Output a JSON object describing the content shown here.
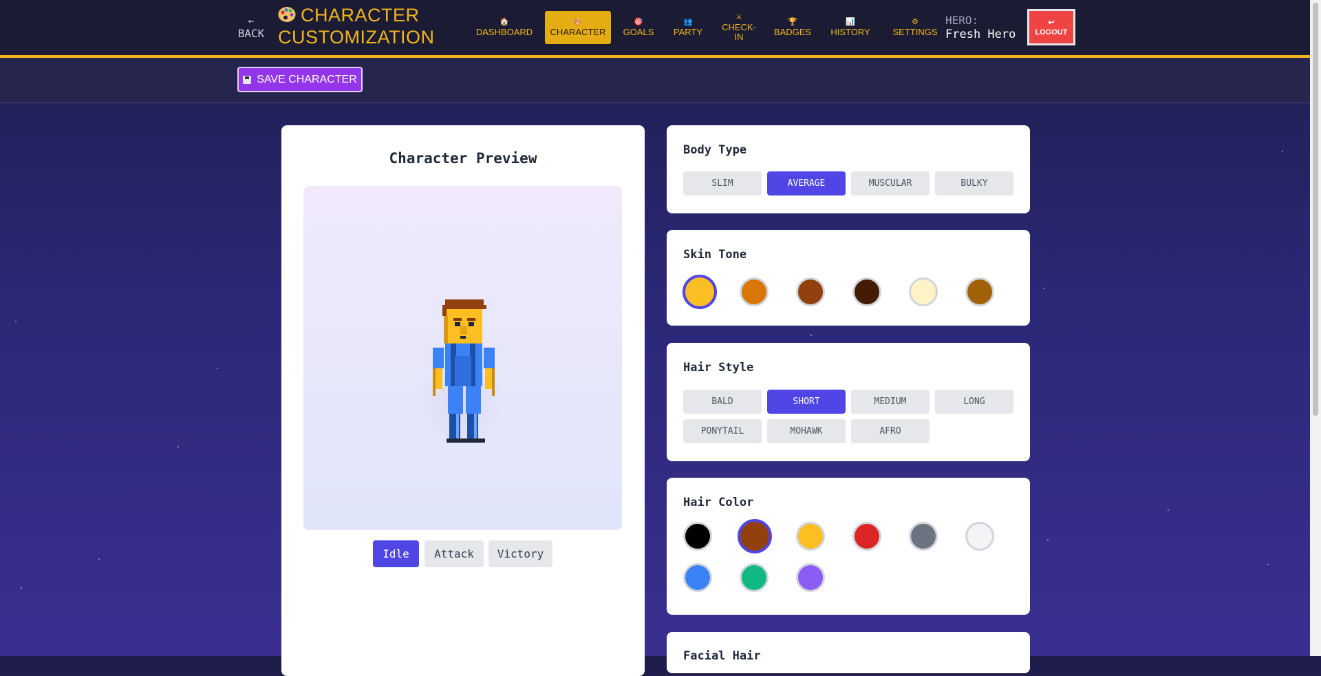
{
  "header": {
    "back_label": "BACK",
    "back_arrow": "←",
    "title_line1": "CHARACTER",
    "title_line2": "CUSTOMIZATION",
    "nav": [
      {
        "icon": "🏠",
        "label": "DASHBOARD",
        "active": false
      },
      {
        "icon": "🎨",
        "label": "CHARACTER",
        "active": true
      },
      {
        "icon": "🎯",
        "label": "GOALS",
        "active": false
      },
      {
        "icon": "👥",
        "label": "PARTY",
        "active": false
      },
      {
        "icon": "⚔",
        "label": "CHECK-IN",
        "active": false
      },
      {
        "icon": "🏆",
        "label": "BADGES",
        "active": false
      },
      {
        "icon": "📊",
        "label": "HISTORY",
        "active": false
      },
      {
        "icon": "⚙",
        "label": "SETTINGS",
        "active": false
      }
    ],
    "checkin_line1": "CHECK-",
    "checkin_line2": "IN",
    "hero_label": "HERO:",
    "hero_name": "Fresh Hero",
    "logout_icon": "↩",
    "logout_label": "LOGOUT"
  },
  "toolbar": {
    "save_label": "SAVE CHARACTER"
  },
  "preview": {
    "title": "Character Preview",
    "animations": [
      "Idle",
      "Attack",
      "Victory"
    ],
    "active_animation": "Idle"
  },
  "body_type": {
    "title": "Body Type",
    "options": [
      "SLIM",
      "AVERAGE",
      "MUSCULAR",
      "BULKY"
    ],
    "selected": "AVERAGE"
  },
  "skin_tone": {
    "title": "Skin Tone",
    "colors": [
      "#fbbf24",
      "#d97706",
      "#92400e",
      "#451a03",
      "#fef3c7",
      "#a16207"
    ],
    "selected_index": 0
  },
  "hair_style": {
    "title": "Hair Style",
    "options": [
      "BALD",
      "SHORT",
      "MEDIUM",
      "LONG",
      "PONYTAIL",
      "MOHAWK",
      "AFRO"
    ],
    "selected": "SHORT"
  },
  "hair_color": {
    "title": "Hair Color",
    "colors": [
      "#000000",
      "#92400e",
      "#fbbf24",
      "#dc2626",
      "#6b7280",
      "#f3f4f6",
      "#3b82f6",
      "#10b981",
      "#8b5cf6"
    ],
    "selected_index": 1
  },
  "facial_hair": {
    "title": "Facial Hair"
  },
  "colors": {
    "accent": "#4f46e5",
    "brand_yellow": "#f3b61c",
    "save_purple": "#9335e8",
    "logout_red": "#ef4444"
  }
}
